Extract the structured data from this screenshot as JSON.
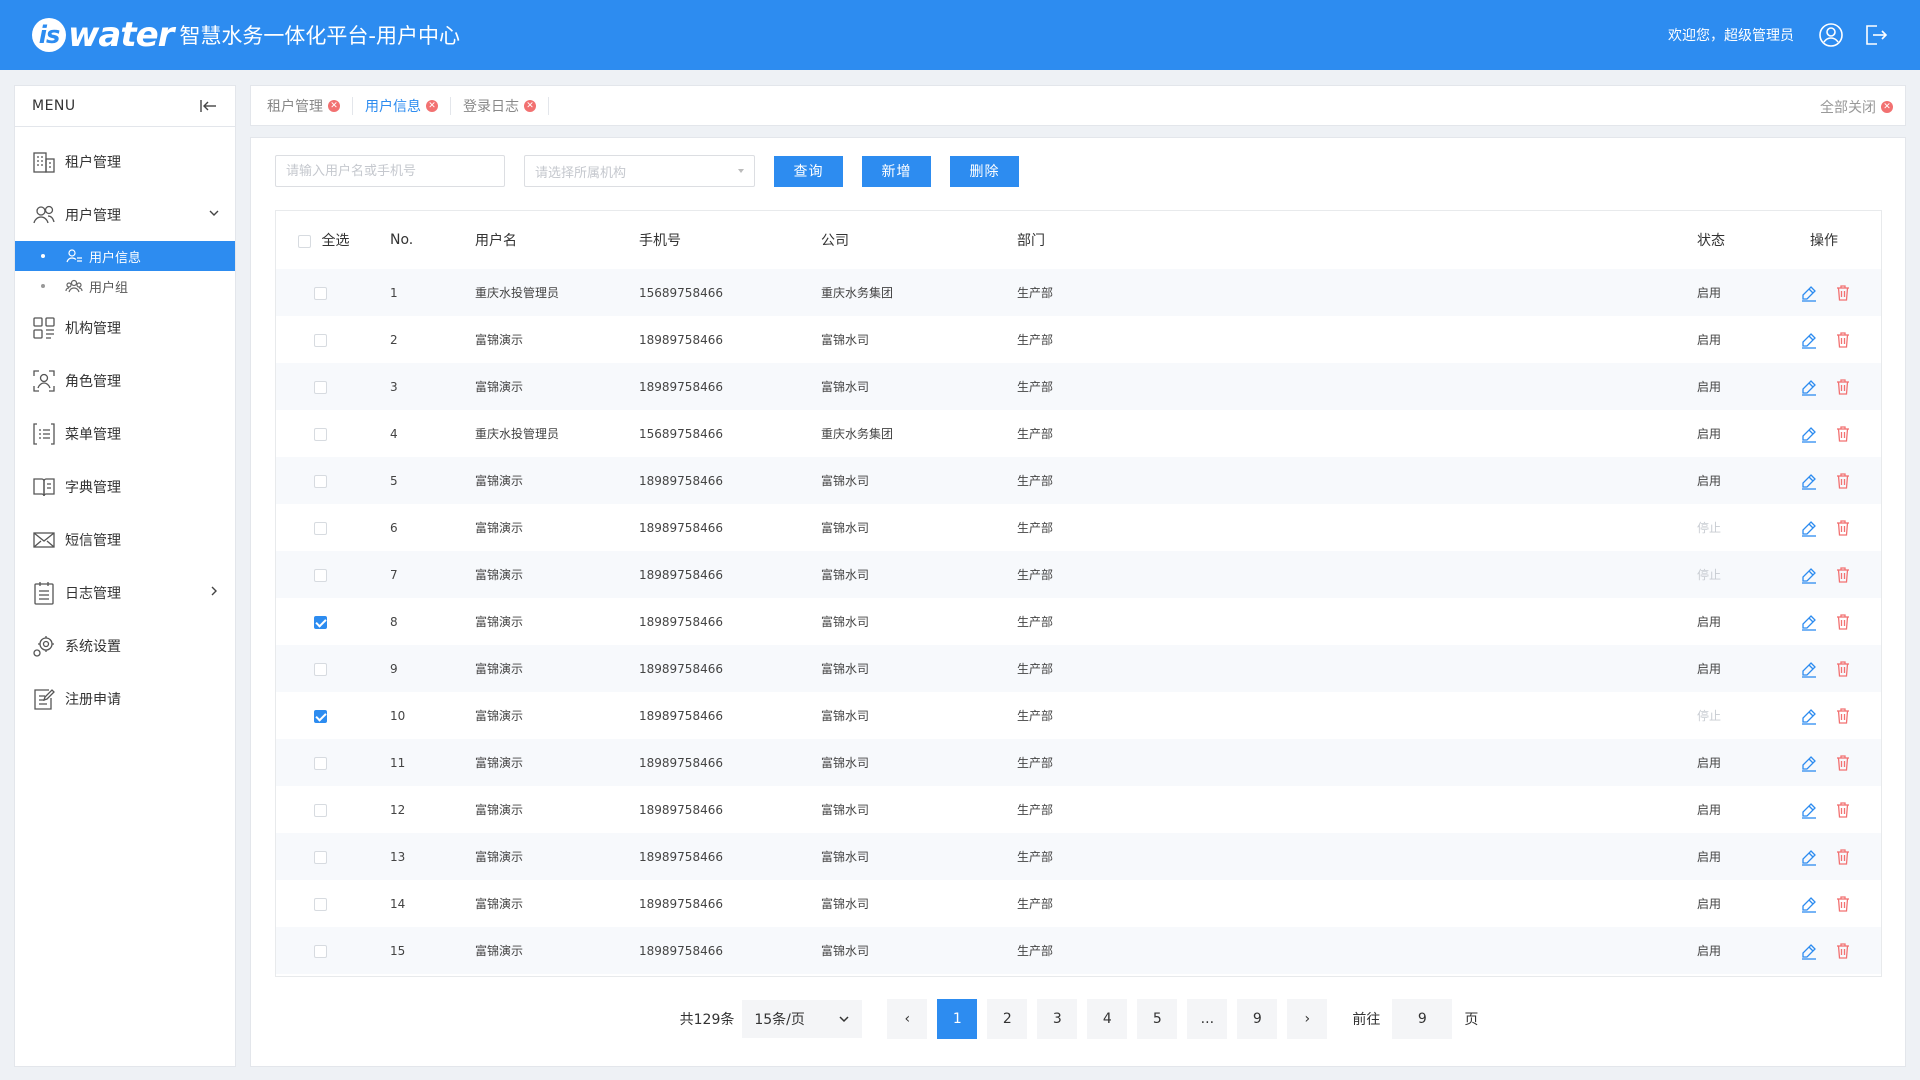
{
  "header": {
    "logo_i": "is",
    "logo_word": "water",
    "title": "智慧水务一体化平台-用户中心",
    "welcome": "欢迎您，超级管理员"
  },
  "sidebar": {
    "menu_label": "MENU",
    "items": [
      {
        "label": "租户管理",
        "icon": "building-icon"
      },
      {
        "label": "用户管理",
        "icon": "users-icon",
        "expanded": true
      },
      {
        "label": "机构管理",
        "icon": "org-icon"
      },
      {
        "label": "角色管理",
        "icon": "role-icon"
      },
      {
        "label": "菜单管理",
        "icon": "menu-list-icon"
      },
      {
        "label": "字典管理",
        "icon": "book-icon"
      },
      {
        "label": "短信管理",
        "icon": "mail-icon"
      },
      {
        "label": "日志管理",
        "icon": "log-icon"
      },
      {
        "label": "系统设置",
        "icon": "settings-icon"
      },
      {
        "label": "注册申请",
        "icon": "register-icon"
      }
    ],
    "subitems": [
      {
        "label": "用户信息",
        "icon": "user-info-icon",
        "active": true
      },
      {
        "label": "用户组",
        "icon": "user-group-icon",
        "active": false
      }
    ]
  },
  "tabs": {
    "items": [
      {
        "label": "租户管理",
        "active": false
      },
      {
        "label": "用户信息",
        "active": true
      },
      {
        "label": "登录日志",
        "active": false
      }
    ],
    "close_all": "全部关闭"
  },
  "toolbar": {
    "search_placeholder": "请输入用户名或手机号",
    "org_placeholder": "请选择所属机构",
    "query_label": "查询",
    "add_label": "新增",
    "delete_label": "删除"
  },
  "table": {
    "headers": {
      "select_all": "全选",
      "no": "No.",
      "username": "用户名",
      "phone": "手机号",
      "company": "公司",
      "department": "部门",
      "status": "状态",
      "action": "操作"
    },
    "rows": [
      {
        "no": "1",
        "username": "重庆水投管理员",
        "phone": "15689758466",
        "company": "重庆水务集团",
        "department": "生产部",
        "status": "启用",
        "checked": false
      },
      {
        "no": "2",
        "username": "富锦演示",
        "phone": "18989758466",
        "company": "富锦水司",
        "department": "生产部",
        "status": "启用",
        "checked": false
      },
      {
        "no": "3",
        "username": "富锦演示",
        "phone": "18989758466",
        "company": "富锦水司",
        "department": "生产部",
        "status": "启用",
        "checked": false
      },
      {
        "no": "4",
        "username": "重庆水投管理员",
        "phone": "15689758466",
        "company": "重庆水务集团",
        "department": "生产部",
        "status": "启用",
        "checked": false
      },
      {
        "no": "5",
        "username": "富锦演示",
        "phone": "18989758466",
        "company": "富锦水司",
        "department": "生产部",
        "status": "启用",
        "checked": false
      },
      {
        "no": "6",
        "username": "富锦演示",
        "phone": "18989758466",
        "company": "富锦水司",
        "department": "生产部",
        "status": "停止",
        "checked": false
      },
      {
        "no": "7",
        "username": "富锦演示",
        "phone": "18989758466",
        "company": "富锦水司",
        "department": "生产部",
        "status": "停止",
        "checked": false
      },
      {
        "no": "8",
        "username": "富锦演示",
        "phone": "18989758466",
        "company": "富锦水司",
        "department": "生产部",
        "status": "启用",
        "checked": true
      },
      {
        "no": "9",
        "username": "富锦演示",
        "phone": "18989758466",
        "company": "富锦水司",
        "department": "生产部",
        "status": "启用",
        "checked": false
      },
      {
        "no": "10",
        "username": "富锦演示",
        "phone": "18989758466",
        "company": "富锦水司",
        "department": "生产部",
        "status": "停止",
        "checked": true
      },
      {
        "no": "11",
        "username": "富锦演示",
        "phone": "18989758466",
        "company": "富锦水司",
        "department": "生产部",
        "status": "启用",
        "checked": false
      },
      {
        "no": "12",
        "username": "富锦演示",
        "phone": "18989758466",
        "company": "富锦水司",
        "department": "生产部",
        "status": "启用",
        "checked": false
      },
      {
        "no": "13",
        "username": "富锦演示",
        "phone": "18989758466",
        "company": "富锦水司",
        "department": "生产部",
        "status": "启用",
        "checked": false
      },
      {
        "no": "14",
        "username": "富锦演示",
        "phone": "18989758466",
        "company": "富锦水司",
        "department": "生产部",
        "status": "启用",
        "checked": false
      },
      {
        "no": "15",
        "username": "富锦演示",
        "phone": "18989758466",
        "company": "富锦水司",
        "department": "生产部",
        "status": "启用",
        "checked": false
      }
    ]
  },
  "pagination": {
    "total": "共129条",
    "page_size": "15条/页",
    "prev": "‹",
    "next": "›",
    "pages": [
      "1",
      "2",
      "3",
      "4",
      "5",
      "...",
      "9"
    ],
    "current": "1",
    "goto_label": "前往",
    "goto_value": "9",
    "goto_unit": "页"
  },
  "colors": {
    "primary": "#2d8cf0",
    "danger": "#f27171",
    "status_off": "#c8ccd2"
  }
}
